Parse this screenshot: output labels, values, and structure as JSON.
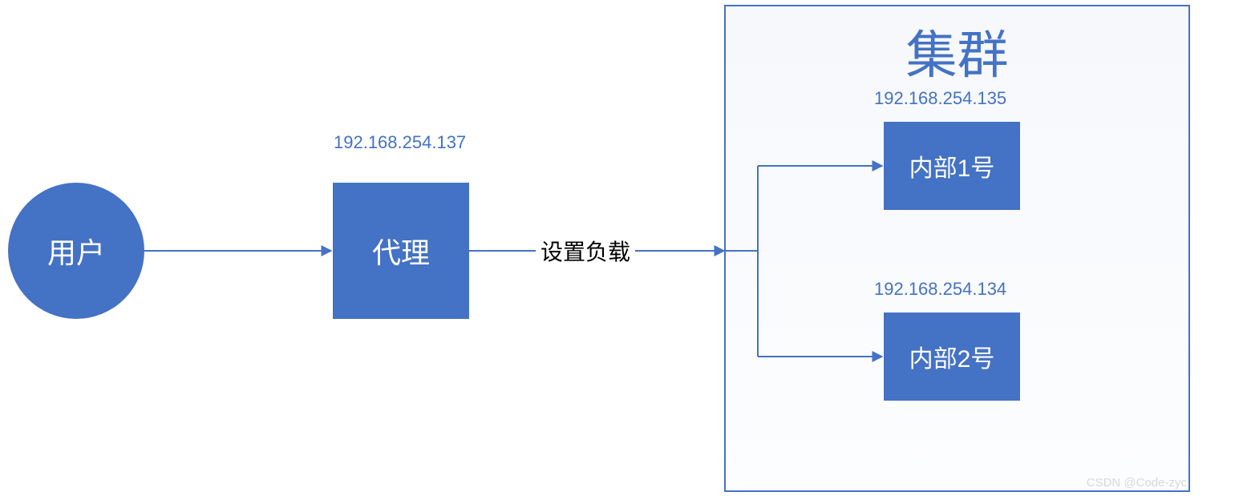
{
  "nodes": {
    "user": {
      "label": "用户"
    },
    "proxy": {
      "label": "代理",
      "ip": "192.168.254.137"
    },
    "cluster": {
      "title": "集群",
      "servers": [
        {
          "label": "内部1号",
          "ip": "192.168.254.135"
        },
        {
          "label": "内部2号",
          "ip": "192.168.254.134"
        }
      ]
    }
  },
  "edges": {
    "proxy_to_cluster_label": "设置负载"
  },
  "watermark": "CSDN @Code-zyc",
  "colors": {
    "node_fill": "#4472c4",
    "node_text": "#ffffff",
    "accent": "#4472c4"
  }
}
